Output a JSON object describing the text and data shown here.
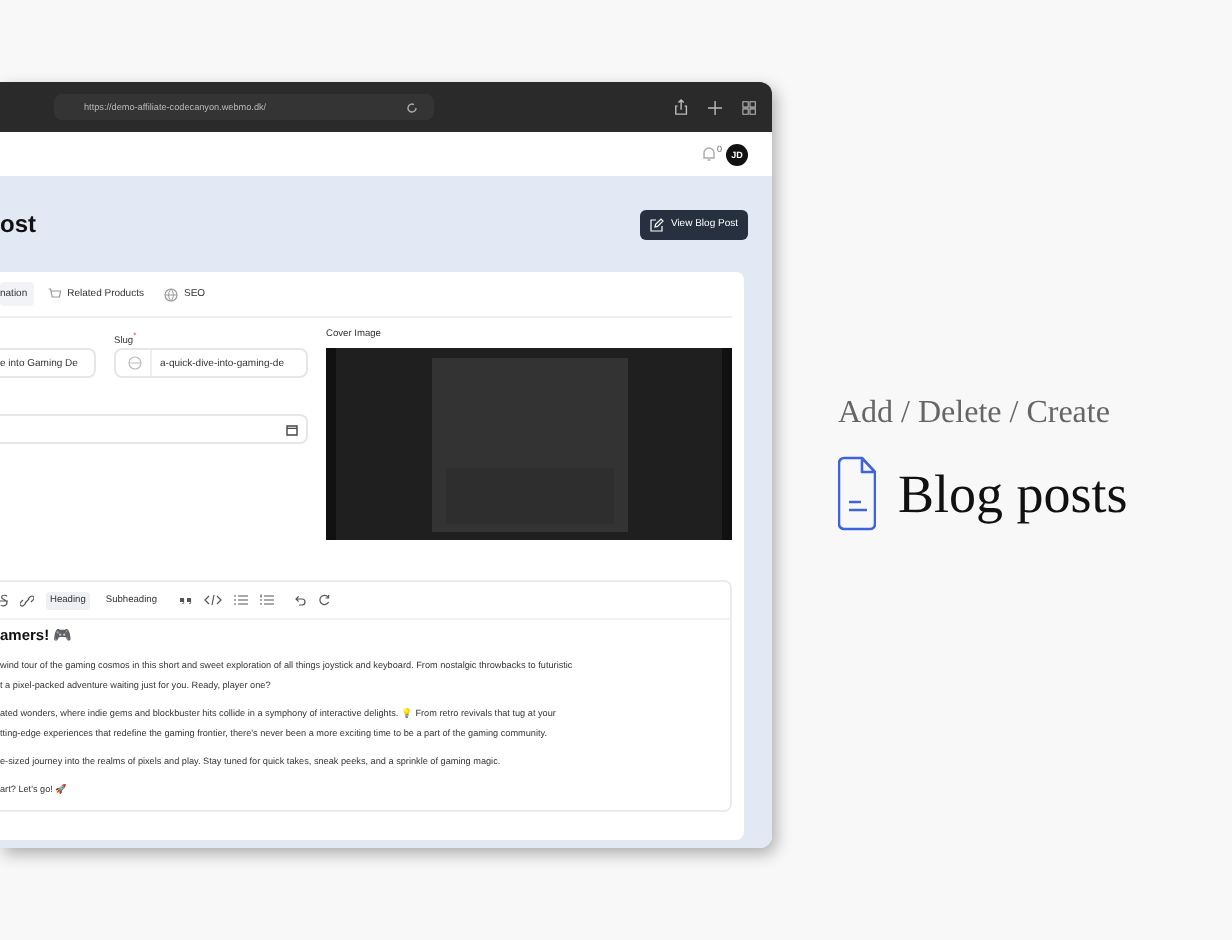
{
  "browser": {
    "url": "https://demo-affiliate-codecanyon.webmo.dk/"
  },
  "header": {
    "notification_count": "0",
    "avatar": "JD"
  },
  "page": {
    "title": "ost",
    "action_button": "View Blog Post"
  },
  "tabs": [
    {
      "label": "nation",
      "kind": "plain",
      "selected": true
    },
    {
      "label": "Related Products",
      "kind": "products",
      "selected": false
    },
    {
      "label": "SEO",
      "kind": "seo",
      "selected": false
    }
  ],
  "form": {
    "title_value": "e into Gaming De",
    "slug_label": "Slug",
    "slug_required_mark": "*",
    "slug_value": "a-quick-dive-into-gaming-de",
    "cover_label": "Cover Image"
  },
  "editor": {
    "toolbar": [
      {
        "kind": "strike"
      },
      {
        "kind": "link"
      },
      {
        "kind": "text",
        "label": "Heading",
        "selected": true
      },
      {
        "kind": "text",
        "label": "Subheading",
        "selected": false
      },
      {
        "kind": "quote"
      },
      {
        "kind": "code"
      },
      {
        "kind": "bullets"
      },
      {
        "kind": "numbers"
      },
      {
        "kind": "undo"
      },
      {
        "kind": "redo"
      }
    ],
    "heading": "amers! 🎮",
    "paragraphs": [
      [
        "wind tour of the gaming cosmos in this short and sweet exploration of all things joystick and keyboard. From nostalgic throwbacks to futuristic",
        "t a pixel-packed adventure waiting just for you. Ready, player one?"
      ],
      [
        "ated wonders, where indie gems and blockbuster hits collide in a symphony of interactive delights. 💡 From retro revivals that tug at your",
        "tting-edge experiences that redefine the gaming frontier, there's never been a more exciting time to be a part of the gaming community."
      ],
      [
        "e-sized journey into the realms of pixels and play. Stay tuned for quick takes, sneak peeks, and a sprinkle of gaming magic."
      ],
      [
        "art? Let's go! 🚀"
      ]
    ]
  },
  "promo": {
    "subtitle": "Add / Delete / Create",
    "title": "Blog posts"
  }
}
